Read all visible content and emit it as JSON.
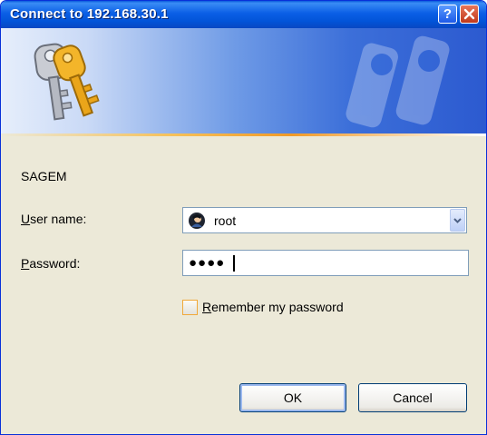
{
  "window": {
    "title": "Connect to 192.168.30.1"
  },
  "titlebar_buttons": {
    "help": "?"
  },
  "dialog": {
    "server_name": "SAGEM",
    "username_label": "User name:",
    "password_label": "Password:",
    "username_value": "root",
    "password_mask": "●●●●",
    "remember_label": "Remember my password",
    "remember_checked": false,
    "ok_label": "OK",
    "cancel_label": "Cancel"
  },
  "icons": {
    "banner": "keys-icon",
    "user": "user-icon",
    "dropdown": "chevron-down-icon",
    "close": "close-icon",
    "help": "help-icon"
  },
  "colors": {
    "titlebar": "#0254d8",
    "dialog_bg": "#ece9d8",
    "checkbox_border": "#f0a93a",
    "input_border": "#7f9db9"
  }
}
